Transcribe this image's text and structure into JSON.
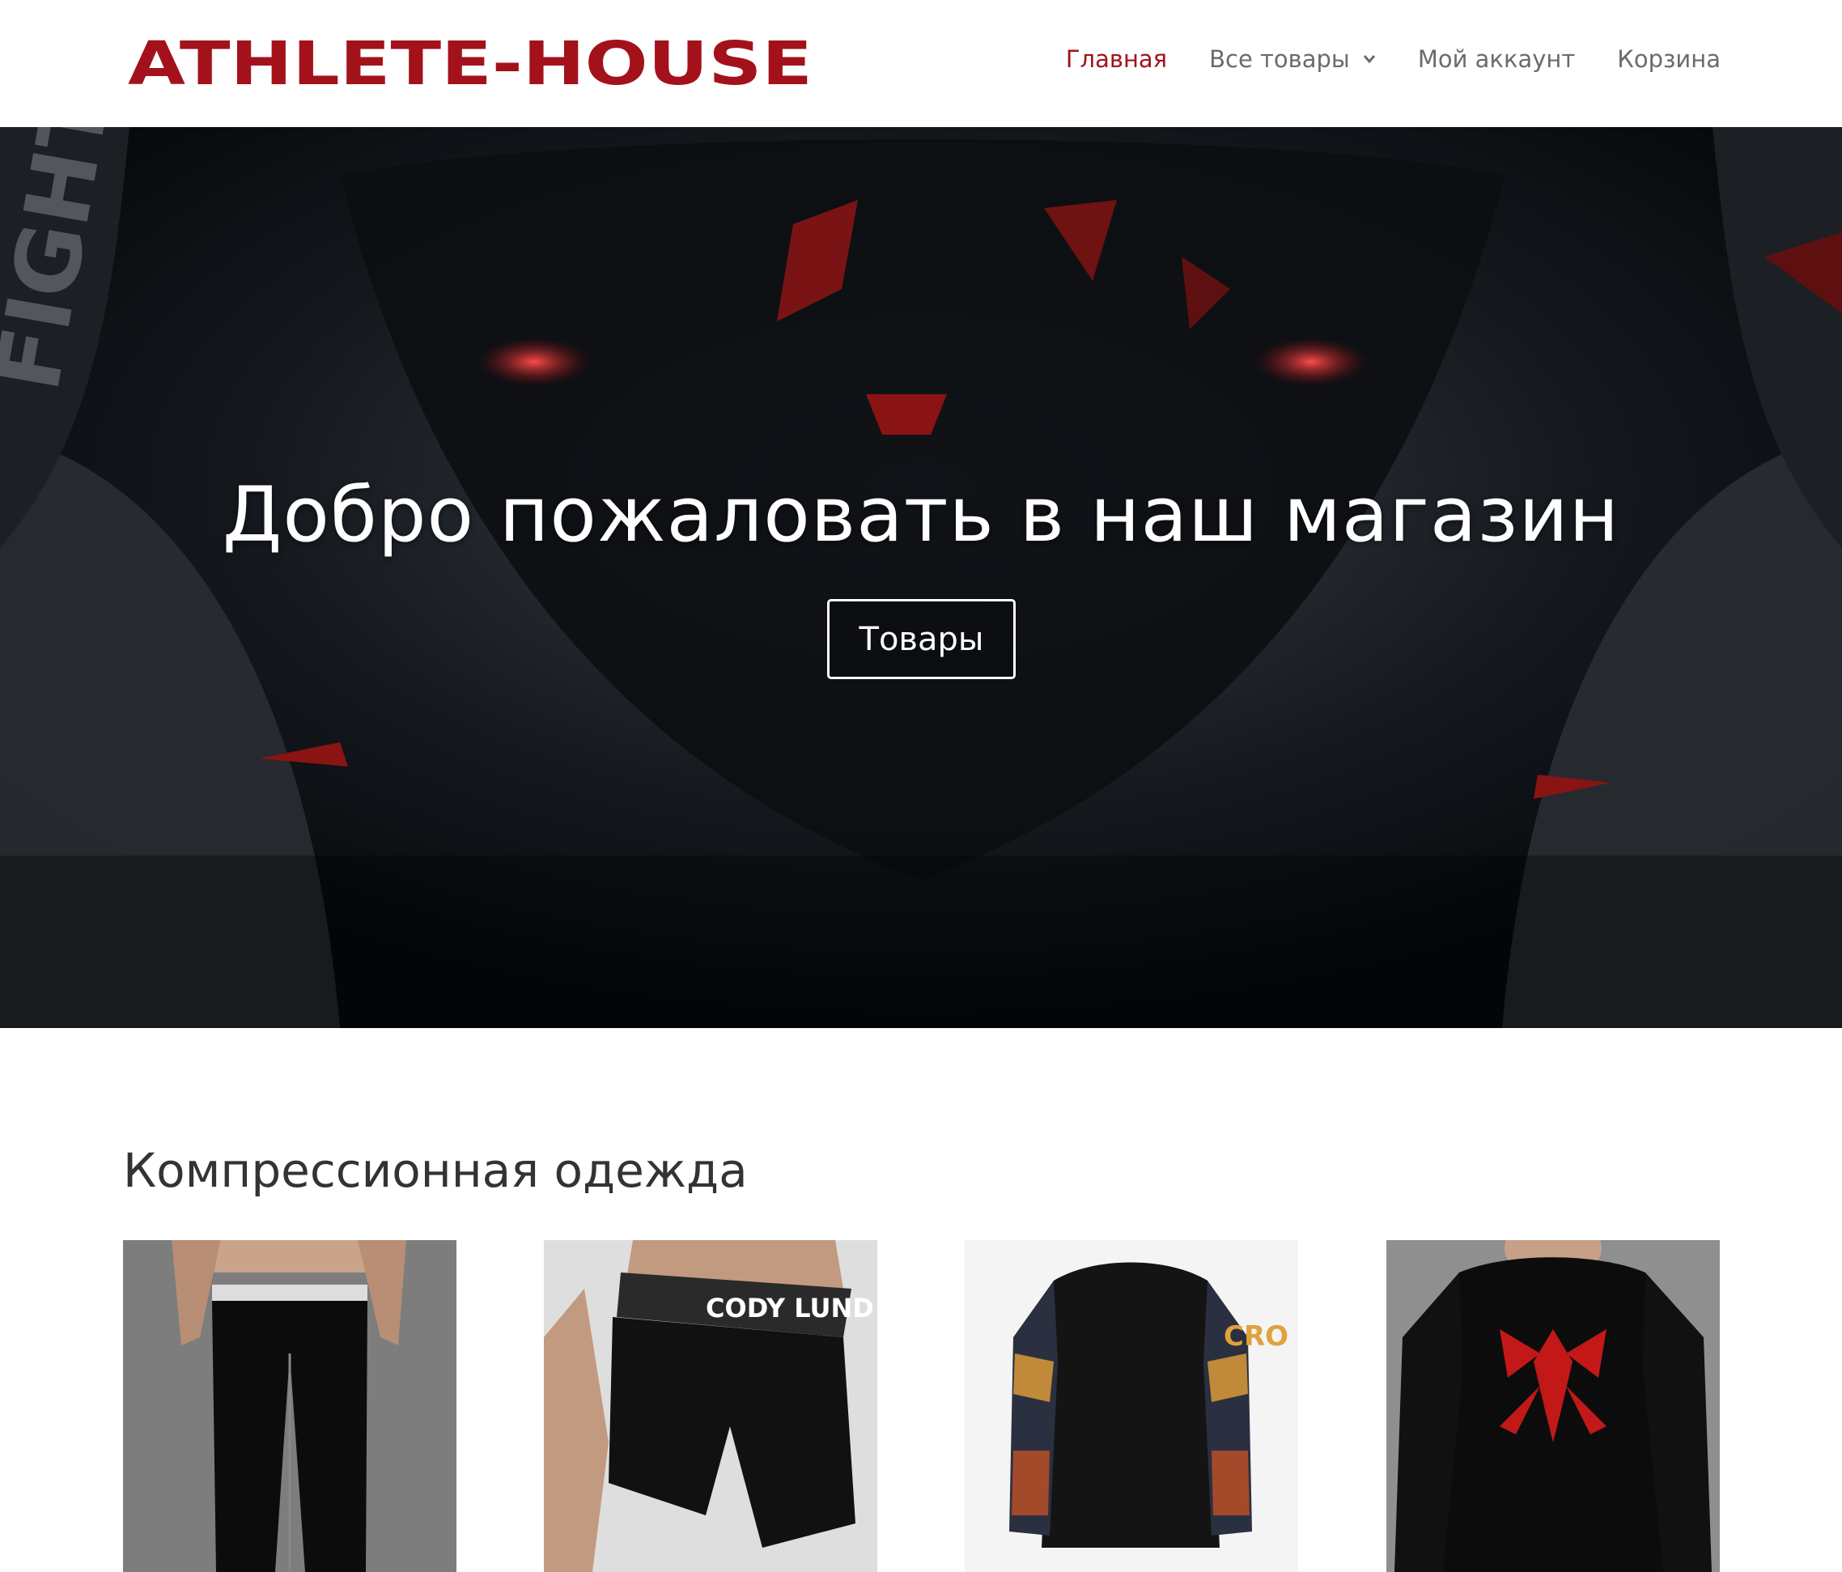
{
  "header": {
    "logo_text": "ATHLETE-HOUSE",
    "nav": [
      {
        "label": "Главная",
        "active": true
      },
      {
        "label": "Все товары",
        "has_dropdown": true
      },
      {
        "label": "Мой аккаунт"
      },
      {
        "label": "Корзина"
      }
    ]
  },
  "hero": {
    "title": "Добро пожаловать в наш магазин",
    "button_label": "Товары",
    "background_text": "FIGHT"
  },
  "section": {
    "title": "Компрессионная одежда"
  },
  "products": [
    {
      "image": "black-compression-leggings"
    },
    {
      "image": "black-compression-shorts",
      "print_text": "CODY LUND"
    },
    {
      "image": "printed-sleeve-rashguard",
      "print_text": "CRO"
    },
    {
      "image": "black-spider-print-longsleeve"
    }
  ],
  "colors": {
    "brand_red": "#a3121b",
    "nav_text": "#6b6b6b",
    "heading_text": "#333333"
  }
}
